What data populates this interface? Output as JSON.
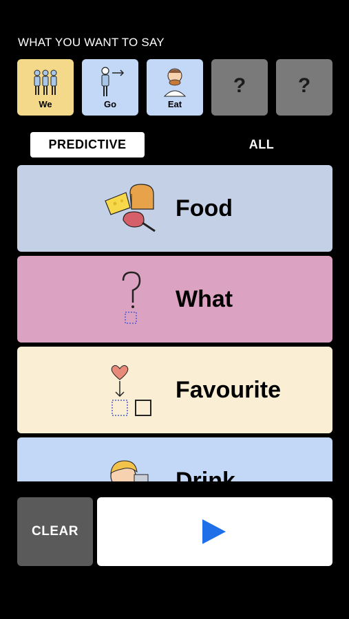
{
  "header": {
    "label": "WHAT YOU WANT TO SAY"
  },
  "phrase_tiles": [
    {
      "label": "We",
      "icon": "people-icon",
      "color": "#f5d98b"
    },
    {
      "label": "Go",
      "icon": "walking-person-icon",
      "color": "#c3d7f7"
    },
    {
      "label": "Eat",
      "icon": "eating-person-icon",
      "color": "#c3d7f7"
    },
    {
      "label": "?",
      "icon": "question-icon",
      "color": "#7a7a7a"
    },
    {
      "label": "?",
      "icon": "question-icon",
      "color": "#7a7a7a"
    }
  ],
  "tabs": {
    "predictive": "PREDICTIVE",
    "all": "ALL"
  },
  "categories": [
    {
      "label": "Food",
      "icon": "food-icon",
      "color": "#c3d0e6"
    },
    {
      "label": "What",
      "icon": "question-mark-icon",
      "color": "#dca2c2"
    },
    {
      "label": "Favourite",
      "icon": "heart-arrow-icon",
      "color": "#faefd4"
    },
    {
      "label": "Drink",
      "icon": "drinking-person-icon",
      "color": "#c3d7f7"
    }
  ],
  "controls": {
    "clear": "CLEAR",
    "play": "play-icon",
    "play_color": "#1f6fe8"
  }
}
